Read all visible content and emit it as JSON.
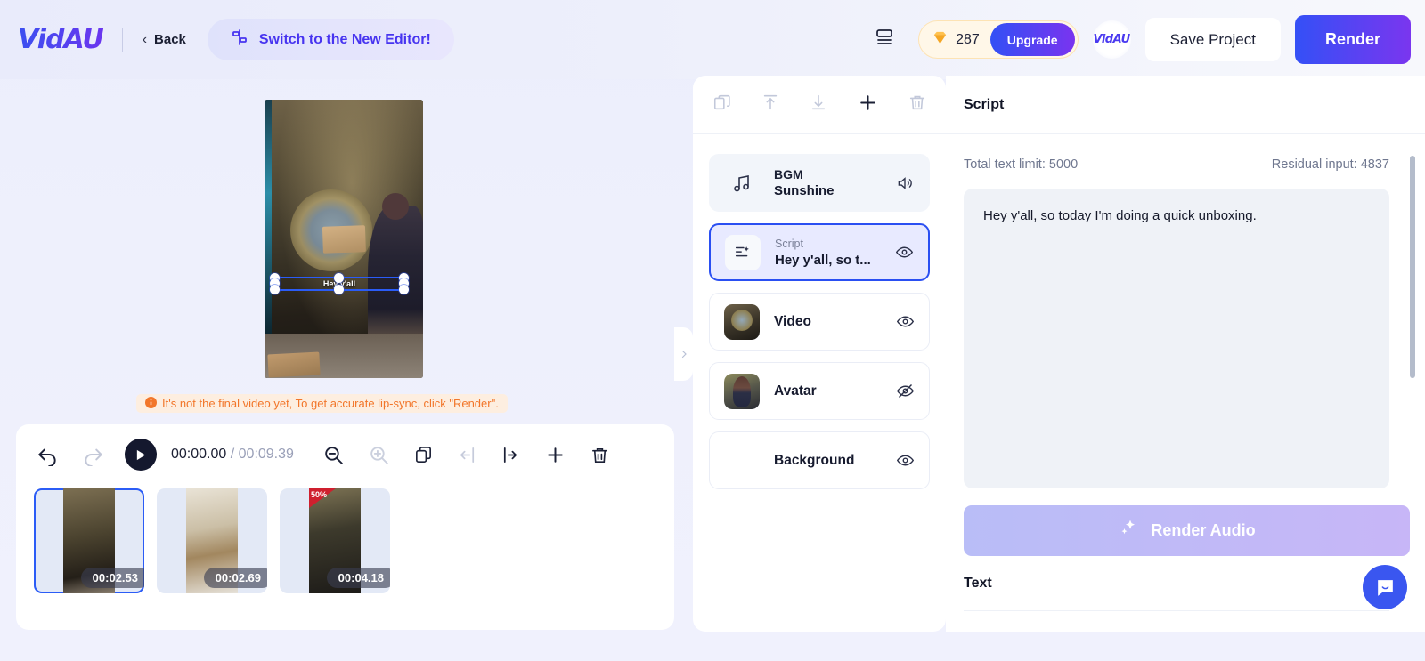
{
  "header": {
    "logo": "VidAU",
    "back_label": "Back",
    "switch_label": "Switch to the New Editor!",
    "layout_icon": "layout-icon",
    "credits": "287",
    "upgrade_label": "Upgrade",
    "user_avatar_label": "VidAU",
    "save_label": "Save Project",
    "render_label": "Render",
    "accent_blue": "#3450f6",
    "accent_purple": "#7a36ef",
    "credit_bg": "#fff7e8"
  },
  "preview": {
    "overlay_text": "Hey y'all",
    "warning": "It's not the final video yet, To get accurate lip-sync, click \"Render\".",
    "warning_color": "#f2762a"
  },
  "timeline": {
    "undo_icon": "undo-icon",
    "redo_icon": "redo-icon",
    "play_icon": "play-icon",
    "current_time": "00:00.00",
    "separator": "/",
    "total_time": "00:09.39",
    "tools": [
      {
        "name": "zoom-out-icon",
        "disabled": false
      },
      {
        "name": "zoom-in-icon",
        "disabled": true
      },
      {
        "name": "duplicate-icon",
        "disabled": false
      },
      {
        "name": "split-left-icon",
        "disabled": true
      },
      {
        "name": "split-right-icon",
        "disabled": false
      },
      {
        "name": "add-icon",
        "disabled": false
      },
      {
        "name": "delete-icon",
        "disabled": false
      }
    ],
    "clips": [
      {
        "duration": "00:02.53",
        "selected": true
      },
      {
        "duration": "00:02.69",
        "selected": false
      },
      {
        "duration": "00:04.18",
        "selected": false
      }
    ]
  },
  "layers_panel": {
    "toolbar": [
      {
        "name": "duplicate-layer-icon"
      },
      {
        "name": "bring-to-front-icon"
      },
      {
        "name": "send-to-back-icon"
      },
      {
        "name": "add-layer-icon"
      },
      {
        "name": "delete-layer-icon"
      }
    ],
    "items": [
      {
        "sub": "BGM",
        "title": "Sunshine",
        "icon": "music-note-icon",
        "action": "volume-icon",
        "kind": "bgm"
      },
      {
        "sub": "Script",
        "title": "Hey y'all, so t...",
        "icon": "script-sparkle-icon",
        "action": "eye-icon",
        "kind": "script",
        "active": true
      },
      {
        "title": "Video",
        "icon": "video-thumbnail",
        "action": "eye-icon",
        "kind": "video"
      },
      {
        "title": "Avatar",
        "icon": "avatar-thumbnail",
        "action": "eye-off-icon",
        "kind": "avatar"
      },
      {
        "title": "Background",
        "icon": "",
        "action": "eye-icon",
        "kind": "background"
      }
    ],
    "collapse_icon": "chevron-right-icon"
  },
  "script_panel": {
    "title": "Script",
    "total_limit": "Total text limit: 5000",
    "residual": "Residual input: 4837",
    "script_text": "Hey y'all, so today I'm doing a quick unboxing.",
    "render_audio_label": "Render Audio",
    "sparkle_icon": "sparkle-icon",
    "text_section_title": "Text",
    "chat_icon": "chat-bubble-icon"
  }
}
